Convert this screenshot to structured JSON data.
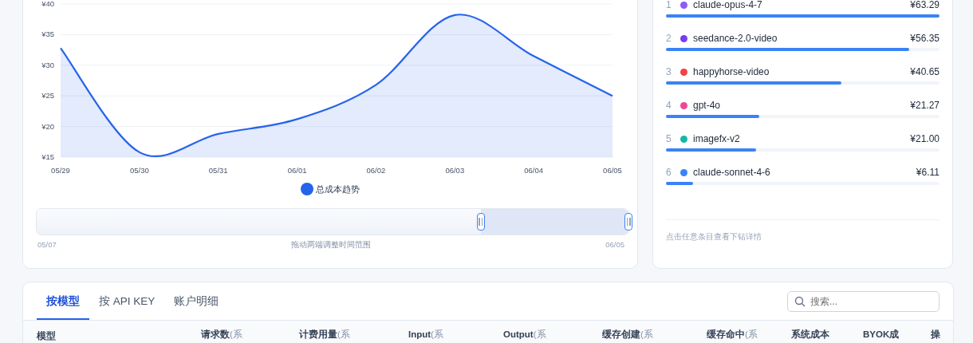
{
  "trend_chart": {
    "chart_data": {
      "type": "area",
      "grid": true,
      "categories": [
        "05/29",
        "05/30",
        "05/31",
        "06/01",
        "06/02",
        "06/03",
        "06/04",
        "06/05"
      ],
      "series": [
        {
          "name": "总成本趋势",
          "color": "#2563eb",
          "values": [
            32.8,
            15.8,
            18.8,
            21.2,
            26.8,
            38.2,
            31.5,
            25.0
          ]
        }
      ],
      "ylim": [
        15,
        40
      ],
      "yticks": [
        {
          "value": 15,
          "label": "¥15"
        },
        {
          "value": 20,
          "label": "¥20"
        },
        {
          "value": 25,
          "label": "¥25"
        },
        {
          "value": 30,
          "label": "¥30"
        },
        {
          "value": 35,
          "label": "¥35"
        },
        {
          "value": 40,
          "label": "¥40"
        }
      ]
    }
  },
  "range_slider": {
    "start_label": "05/07",
    "hint": "拖动两端调整时间范围",
    "end_label": "06/05",
    "level": 0.25
  },
  "ranking": {
    "items": [
      {
        "rank": "1",
        "name": "claude-opus-4-7",
        "color": "#8b5cf6",
        "amount": "¥63.29",
        "level": 1.0
      },
      {
        "rank": "2",
        "name": "seedance-2.0-video",
        "color": "#7c3aed",
        "amount": "¥56.35",
        "level": 0.89
      },
      {
        "rank": "3",
        "name": "happyhorse-video",
        "color": "#ef4444",
        "amount": "¥40.65",
        "level": 0.64
      },
      {
        "rank": "4",
        "name": "gpt-4o",
        "color": "#ec4899",
        "amount": "¥21.27",
        "level": 0.34
      },
      {
        "rank": "5",
        "name": "imagefx-v2",
        "color": "#14b8a6",
        "amount": "¥21.00",
        "level": 0.33
      },
      {
        "rank": "6",
        "name": "claude-sonnet-4-6",
        "color": "#3b82f6",
        "amount": "¥6.11",
        "level": 0.1
      }
    ],
    "footer": "点击任意条目查看下钻详情"
  },
  "table_card": {
    "tabs": [
      {
        "label": "按模型",
        "selected": true
      },
      {
        "label": "按 API KEY",
        "selected": false
      },
      {
        "label": "账户明细",
        "selected": false
      }
    ],
    "search": {
      "placeholder": "搜索..."
    },
    "columns": [
      {
        "label": "模型"
      },
      {
        "label": "请求数",
        "suffix": "(系"
      },
      {
        "label": "计费用量",
        "suffix": "(系"
      },
      {
        "label": "Input",
        "suffix": "(系"
      },
      {
        "label": "Output",
        "suffix": "(系"
      },
      {
        "label": "缓存创建",
        "suffix": "(系"
      },
      {
        "label": "缓存命中",
        "suffix": "(系"
      },
      {
        "label": "系统成本"
      },
      {
        "label": "BYOK成"
      },
      {
        "label": "操"
      }
    ]
  }
}
